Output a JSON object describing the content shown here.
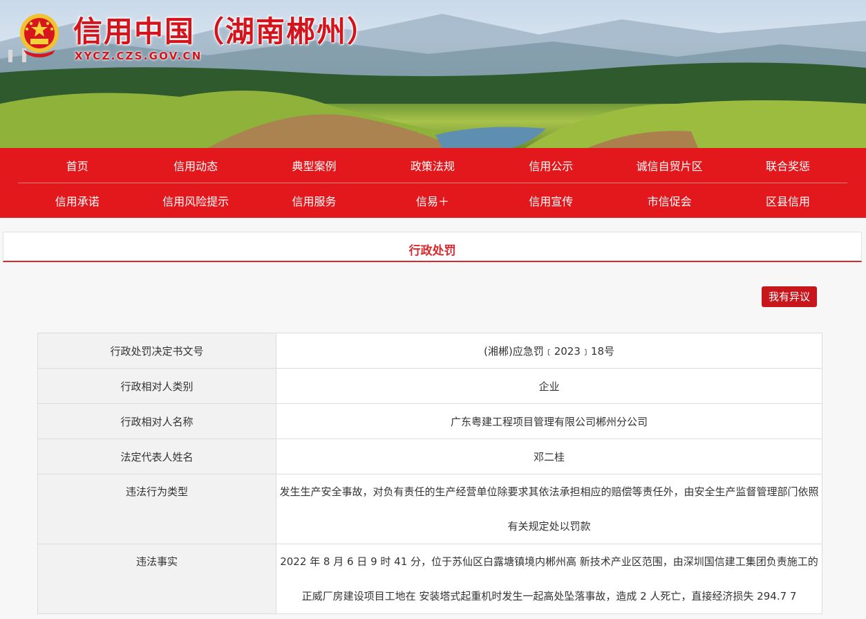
{
  "header": {
    "site_title": "信用中国（湖南郴州）",
    "site_url": "XYCZ.CZS.GOV.CN",
    "emblem_icon": "national-emblem-icon"
  },
  "nav": {
    "row1": [
      "首页",
      "信用动态",
      "典型案例",
      "政策法规",
      "信用公示",
      "诚信自贸片区",
      "联合奖惩"
    ],
    "row2": [
      "信用承诺",
      "信用风险提示",
      "信用服务",
      "信易＋",
      "信用宣传",
      "市信促会",
      "区县信用"
    ]
  },
  "section": {
    "title": "行政处罚",
    "objection_button": "我有异议"
  },
  "table": {
    "rows": [
      {
        "label": "行政处罚决定书文号",
        "value": "(湘郴)应急罚﹝2023﹞18号"
      },
      {
        "label": "行政相对人类别",
        "value": "企业"
      },
      {
        "label": "行政相对人名称",
        "value": "广东粤建工程项目管理有限公司郴州分公司"
      },
      {
        "label": "法定代表人姓名",
        "value": "邓二桂"
      },
      {
        "label": "违法行为类型",
        "value": "发生生产安全事故，对负有责任的生产经营单位除要求其依法承担相应的赔偿等责任外，由安全生产监督管理部门依照有关规定处以罚款"
      },
      {
        "label": "违法事实",
        "value": "2022 年 8 月 6 日 9 时 41 分，位于苏仙区白露塘镇境内郴州高 新技术产业区范围，由深圳国信建工集团负责施工的正威厂房建设项目工地在 安装塔式起重机时发生一起高处坠落事故，造成 2 人死亡，直接经济损失 294.7 7"
      }
    ]
  },
  "colors": {
    "nav_bg": "#e2181d",
    "accent_red": "#d9282d",
    "button_red": "#c8161d"
  }
}
